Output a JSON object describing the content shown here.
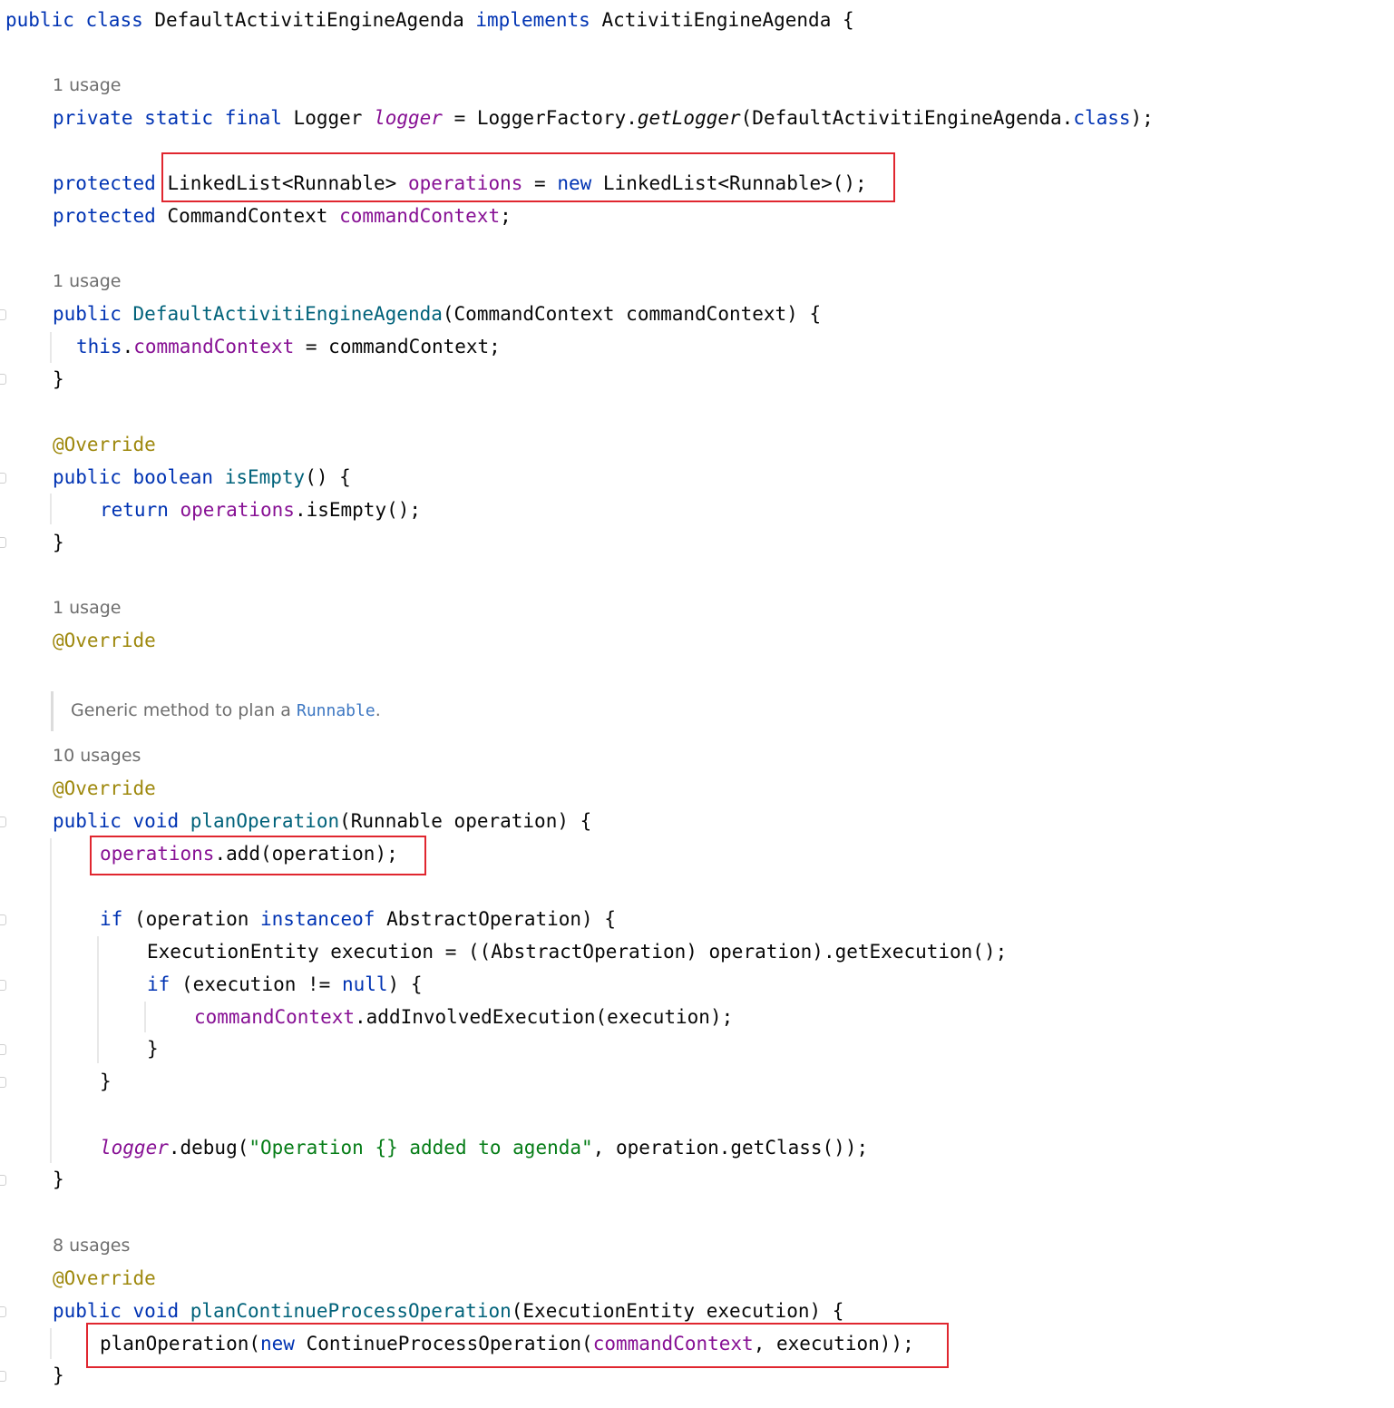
{
  "hints": {
    "h1": "1 usage",
    "h2": "1 usage",
    "h3": "1 usage",
    "h4": "10 usages",
    "h5": "8 usages"
  },
  "doc": {
    "prefix": "Generic method to plan a ",
    "code": "Runnable",
    "suffix": "."
  },
  "code": {
    "l01": [
      "public",
      " ",
      "class",
      " DefaultActivitiEngineAgenda ",
      "implements",
      " ActivitiEngineAgenda {"
    ],
    "l02": [
      "private",
      " ",
      "static",
      " ",
      "final",
      " Logger ",
      "logger",
      " = LoggerFactory.",
      "getLogger",
      "(DefaultActivitiEngineAgenda.",
      "class",
      ");"
    ],
    "l03": [
      "protected",
      " LinkedList<Runnable> ",
      "operations",
      " = ",
      "new",
      " LinkedList<Runnable>();"
    ],
    "l04": [
      "protected",
      " CommandContext ",
      "commandContext",
      ";"
    ],
    "l05": [
      "public",
      " ",
      "DefaultActivitiEngineAgenda",
      "(CommandContext commandContext) {"
    ],
    "l06": [
      "this",
      ".",
      "commandContext",
      " = commandContext;"
    ],
    "l07": [
      "}"
    ],
    "l08": [
      "@Override"
    ],
    "l09": [
      "public",
      " ",
      "boolean",
      " ",
      "isEmpty",
      "() {"
    ],
    "l10": [
      "return",
      " ",
      "operations",
      ".isEmpty();"
    ],
    "l11": [
      "}"
    ],
    "l12": [
      "@Override"
    ],
    "l13": [
      "@Override"
    ],
    "l14": [
      "public",
      " ",
      "void",
      " ",
      "planOperation",
      "(Runnable operation) {"
    ],
    "l15": [
      "operations",
      ".add(operation);"
    ],
    "l16": [
      "if",
      " (operation ",
      "instanceof",
      " AbstractOperation) {"
    ],
    "l17": [
      "ExecutionEntity execution = ((AbstractOperation) operation).getExecution();"
    ],
    "l18": [
      "if",
      " (execution != ",
      "null",
      ") {"
    ],
    "l19": [
      "commandContext",
      ".addInvolvedExecution(execution);"
    ],
    "l20": [
      "}"
    ],
    "l21": [
      "}"
    ],
    "l22": [
      "logger",
      ".debug(",
      "\"Operation {} added to agenda\"",
      ", operation.getClass());"
    ],
    "l23": [
      "}"
    ],
    "l24": [
      "@Override"
    ],
    "l25": [
      "public",
      " ",
      "void",
      " ",
      "planContinueProcessOperation",
      "(ExecutionEntity execution) {"
    ],
    "l26": [
      "planOperation(",
      "new",
      " ContinueProcessOperation(",
      "commandContext",
      ", execution));"
    ],
    "l27": [
      "}"
    ]
  },
  "colors": {
    "keyword": "#0033b3",
    "field": "#871094",
    "method_declaration": "#00627a",
    "annotation": "#9e880d",
    "string": "#067d17",
    "highlight_box": "#e0262f"
  }
}
